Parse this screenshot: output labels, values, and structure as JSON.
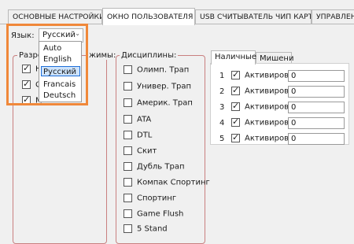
{
  "tabs": [
    {
      "label": "ОСНОВНЫЕ НАСТРОЙКИ"
    },
    {
      "label": "ОКНО ПОЛЬЗОВАТЕЛЯ"
    },
    {
      "label": "USB СЧИТЫВАТЕЛЬ ЧИП КАРТ"
    },
    {
      "label": "УПРАВЛЕНИ"
    }
  ],
  "language": {
    "label": "Язык:",
    "selected": "Русский",
    "options": [
      "Auto",
      "English",
      "Русский",
      "Francais",
      "Deutsch"
    ]
  },
  "permissions": {
    "title_visible": "Разре",
    "title_tail": "жимы:",
    "items": [
      {
        "label": "Н",
        "checked": true
      },
      {
        "label": "С",
        "checked": true
      },
      {
        "label": "М",
        "checked": true
      }
    ]
  },
  "disciplines": {
    "title": "Дисциплины:",
    "items": [
      {
        "label": "Олимп. Трап",
        "checked": false
      },
      {
        "label": "Универ. Трап",
        "checked": false
      },
      {
        "label": "Америк. Трап",
        "checked": false
      },
      {
        "label": "ATA",
        "checked": false
      },
      {
        "label": "DTL",
        "checked": false
      },
      {
        "label": "Скит",
        "checked": false
      },
      {
        "label": "Дубль Трап",
        "checked": false
      },
      {
        "label": "Компак Спортинг",
        "checked": false
      },
      {
        "label": "Спортинг",
        "checked": false
      },
      {
        "label": "Game Flush",
        "checked": false
      },
      {
        "label": "5 Stand",
        "checked": false
      }
    ]
  },
  "payment": {
    "tabs": [
      "Наличные",
      "Мишени"
    ],
    "rows": [
      {
        "num": "1",
        "label": "Активировать",
        "checked": true,
        "value": "0"
      },
      {
        "num": "2",
        "label": "Активировать",
        "checked": true,
        "value": "0"
      },
      {
        "num": "3",
        "label": "Активировать",
        "checked": true,
        "value": "0"
      },
      {
        "num": "4",
        "label": "Активировать",
        "checked": true,
        "value": "0"
      },
      {
        "num": "5",
        "label": "Активировать",
        "checked": true,
        "value": "0"
      }
    ]
  }
}
